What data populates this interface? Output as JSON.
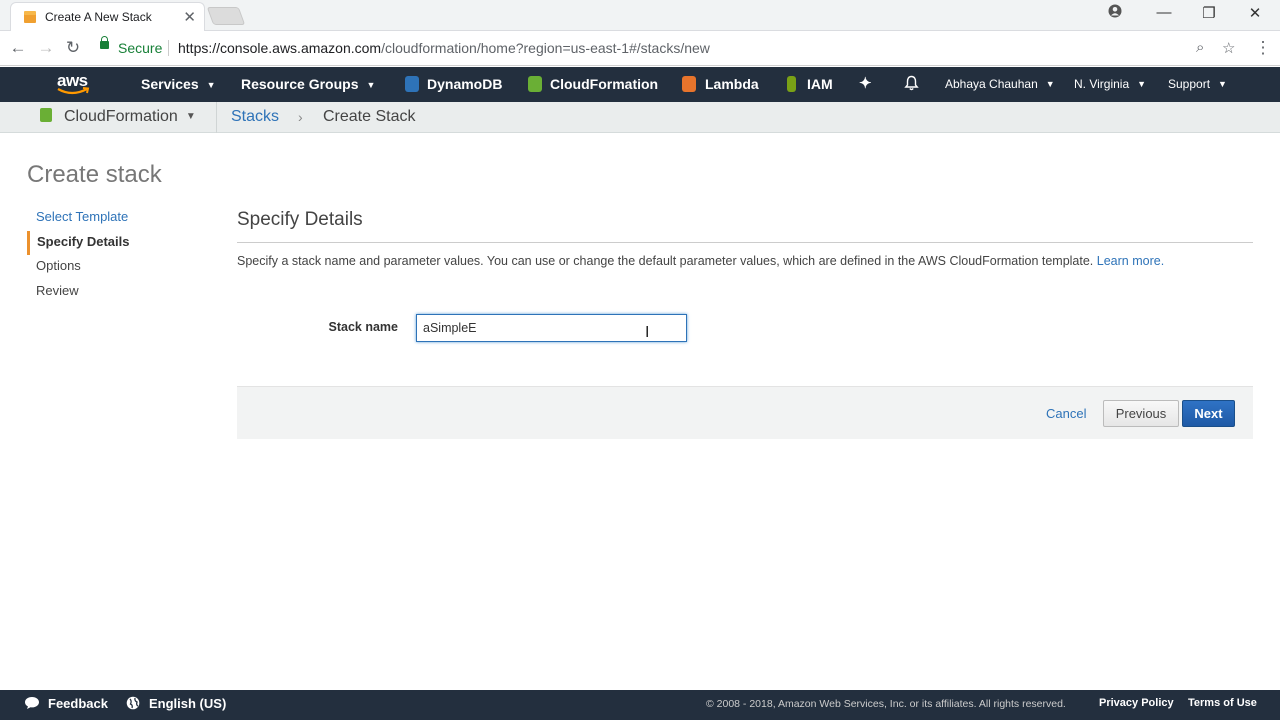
{
  "browser": {
    "tab_title": "Create A New Stack",
    "secure_label": "Secure",
    "url_host": "https://console.aws.amazon.com",
    "url_path": "/cloudformation/home?region=us-east-1#/stacks/new"
  },
  "aws_nav": {
    "logo_text": "aws",
    "services": "Services",
    "resource_groups": "Resource Groups",
    "shortcuts": [
      "DynamoDB",
      "CloudFormation",
      "Lambda",
      "IAM"
    ],
    "user": "Abhaya Chauhan",
    "region": "N. Virginia",
    "support": "Support",
    "colors": {
      "nav_bg": "#232f3e",
      "dynamodb": "#2e73b8",
      "cloudformation": "#6aaf35",
      "lambda": "#e7742c",
      "iam": "#7aa116"
    }
  },
  "breadcrumb": {
    "service": "CloudFormation",
    "stacks": "Stacks",
    "current": "Create Stack"
  },
  "page": {
    "title": "Create stack",
    "steps": [
      "Select Template",
      "Specify Details",
      "Options",
      "Review"
    ],
    "active_step": "Specify Details"
  },
  "form": {
    "section_title": "Specify Details",
    "description": "Specify a stack name and parameter values. You can use or change the default parameter values, which are defined in the AWS CloudFormation template.",
    "learn_more": "Learn more.",
    "stack_name_label": "Stack name",
    "stack_name_value": "aSimpleE"
  },
  "actions": {
    "cancel": "Cancel",
    "previous": "Previous",
    "next": "Next"
  },
  "footer": {
    "feedback": "Feedback",
    "language": "English (US)",
    "copyright": "© 2008 - 2018, Amazon Web Services, Inc. or its affiliates. All rights reserved.",
    "privacy": "Privacy Policy",
    "terms": "Terms of Use"
  }
}
